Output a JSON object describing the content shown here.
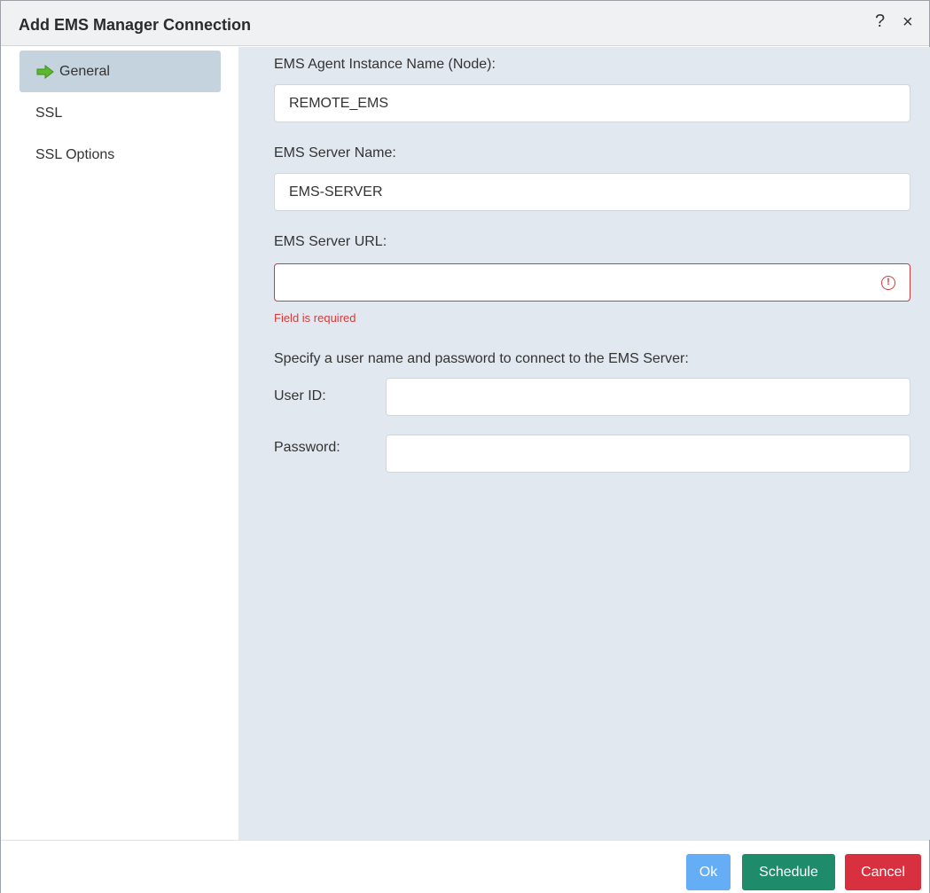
{
  "window": {
    "title": "Add EMS Manager Connection",
    "help_glyph": "?",
    "close_glyph": "×"
  },
  "sidebar": {
    "items": [
      {
        "label": "General",
        "icon": "right-arrow-icon",
        "active": true
      },
      {
        "label": "SSL",
        "active": false
      },
      {
        "label": "SSL Options",
        "active": false
      }
    ]
  },
  "form": {
    "instance": {
      "label": "EMS Agent Instance Name (Node):",
      "value": "REMOTE_EMS"
    },
    "server_name": {
      "label": "EMS Server Name:",
      "value": "EMS-SERVER"
    },
    "server_url": {
      "label": "EMS Server URL:",
      "value": "",
      "error": "Field is required",
      "error_icon": "exclamation-circle-icon"
    },
    "credentials_hint": "Specify a user name and password to connect to the EMS Server:",
    "user_id": {
      "label": "User ID:",
      "value": ""
    },
    "password": {
      "label": "Password:",
      "value": ""
    }
  },
  "footer": {
    "ok_label": "Ok",
    "schedule_label": "Schedule",
    "cancel_label": "Cancel"
  },
  "colors": {
    "ok": "#65aef5",
    "schedule": "#1e8c6b",
    "cancel": "#d8303f",
    "error": "#d63b3b",
    "nav_active": "#c5d3de",
    "arrow": "#5cb82e"
  }
}
